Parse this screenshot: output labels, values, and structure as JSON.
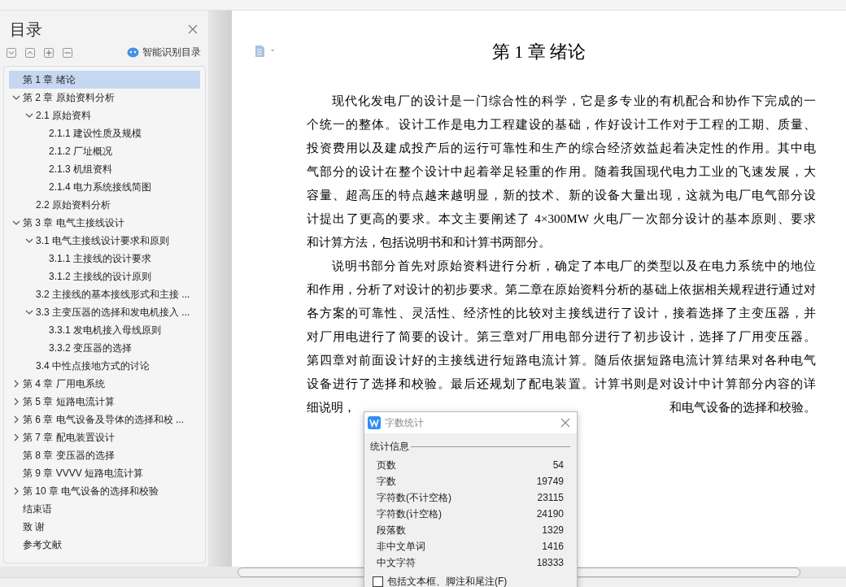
{
  "sidebar": {
    "title": "目录",
    "smart_button": "智能识别目录",
    "tree": [
      {
        "label": "第 1 章  绪论",
        "selected": true
      },
      {
        "label": "第 2 章  原始资料分析",
        "selected": false,
        "expanded": true,
        "children": [
          {
            "label": "2.1  原始资料",
            "selected": false,
            "expanded": true,
            "children": [
              {
                "label": "2.1.1  建设性质及规模",
                "selected": false
              },
              {
                "label": "2.1.2  厂址概况",
                "selected": false
              },
              {
                "label": "2.1.3  机组资料",
                "selected": false
              },
              {
                "label": "2.1.4  电力系统接线简图",
                "selected": false
              }
            ]
          },
          {
            "label": "2.2  原始资料分析",
            "selected": false
          }
        ]
      },
      {
        "label": "第 3 章  电气主接线设计",
        "selected": false,
        "expanded": true,
        "children": [
          {
            "label": "3.1  电气主接线设计要求和原则",
            "selected": false,
            "expanded": true,
            "children": [
              {
                "label": "3.1.1  主接线的设计要求",
                "selected": false
              },
              {
                "label": "3.1.2  主接线的设计原则",
                "selected": false
              }
            ]
          },
          {
            "label": "3.2  主接线的基本接线形式和主接 ...",
            "selected": false
          },
          {
            "label": "3.3  主变压器的选择和发电机接入 ...",
            "selected": false,
            "expanded": true,
            "children": [
              {
                "label": "3.3.1  发电机接入母线原则",
                "selected": false
              },
              {
                "label": "3.3.2  变压器的选择",
                "selected": false
              }
            ]
          },
          {
            "label": "3.4  中性点接地方式的讨论",
            "selected": false
          }
        ]
      },
      {
        "label": "第 4 章  厂用电系统",
        "selected": false,
        "expanded": false
      },
      {
        "label": "第 5 章  短路电流计算",
        "selected": false,
        "expanded": false
      },
      {
        "label": "第 6 章  电气设备及导体的选择和校 ...",
        "selected": false,
        "expanded": false
      },
      {
        "label": "第 7 章  配电装置设计",
        "selected": false,
        "expanded": false
      },
      {
        "label": "第 8 章  变压器的选择",
        "selected": false
      },
      {
        "label": "第 9 章  VVVV  短路电流计算",
        "selected": false
      },
      {
        "label": "第 10 章  电气设备的选择和校验",
        "selected": false,
        "expanded": false
      },
      {
        "label": "结束语",
        "selected": false
      },
      {
        "label": "致    谢",
        "selected": false
      },
      {
        "label": "参考文献",
        "selected": false
      }
    ]
  },
  "document": {
    "heading": "第 1 章  绪论",
    "paragraphs": [
      {
        "lines": [
          "现代化发电厂的设计是一门综合性的科学，它是多专业的有机配合和协作下完成的一",
          "个统一的整体。设计工作是电力工程建设的基础，作好设计工作对于工程的工期、质量、",
          "投资费用以及建成投产后的运行可靠性和生产的综合经济效益起着决定性的作用。其中电",
          "气部分的设计在整个设计中起着举足轻重的作用。随着我国现代电力工业的飞速发展，大",
          "容量、超高压的特点越来越明显，新的技术、新的设备大量出现，这就为电厂电气部分设",
          "计提出了更高的要求。本文主要阐述了 4×300MW 火电厂一次部分设计的基本原则、要求",
          "和计算方法，包括说明书和和计算书两部分。"
        ]
      },
      {
        "lines": [
          "说明书部分首先对原始资料进行分析，确定了本电厂的类型以及在电力系统中的地位",
          "和作用，分析了对设计的初步要求。第二章在原始资料分析的基础上依据相关规程进行通过对",
          "各方案的可靠性、灵活性、经济性的比较对主接线进行了设计，接着选择了主变压器，并",
          "对厂用电进行了简要的设计。第三章对厂用电部分进行了初步设计，选择了厂用变压器。",
          "第四章对前面设计好的主接线进行短路电流计算。随后依据短路电流计算结果对各种电气",
          "设备进行了选择和校验。最后还规划了配电装置。计算书则是对设计中计算部分内容的详"
        ],
        "tail": [
          "细说明，",
          "和电气设备的选择和校验。"
        ]
      }
    ]
  },
  "dialog": {
    "title": "字数统计",
    "group": "统计信息",
    "rows": [
      {
        "label": "页数",
        "value": "54"
      },
      {
        "label": "字数",
        "value": "19749"
      },
      {
        "label": "字符数(不计空格)",
        "value": "23115"
      },
      {
        "label": "字符数(计空格)",
        "value": "24190"
      },
      {
        "label": "段落数",
        "value": "1329"
      },
      {
        "label": "非中文单词",
        "value": "1416"
      },
      {
        "label": "中文字符",
        "value": "18333"
      }
    ],
    "checkbox": {
      "label": "包括文本框、脚注和尾注(F)",
      "checked": false
    }
  }
}
